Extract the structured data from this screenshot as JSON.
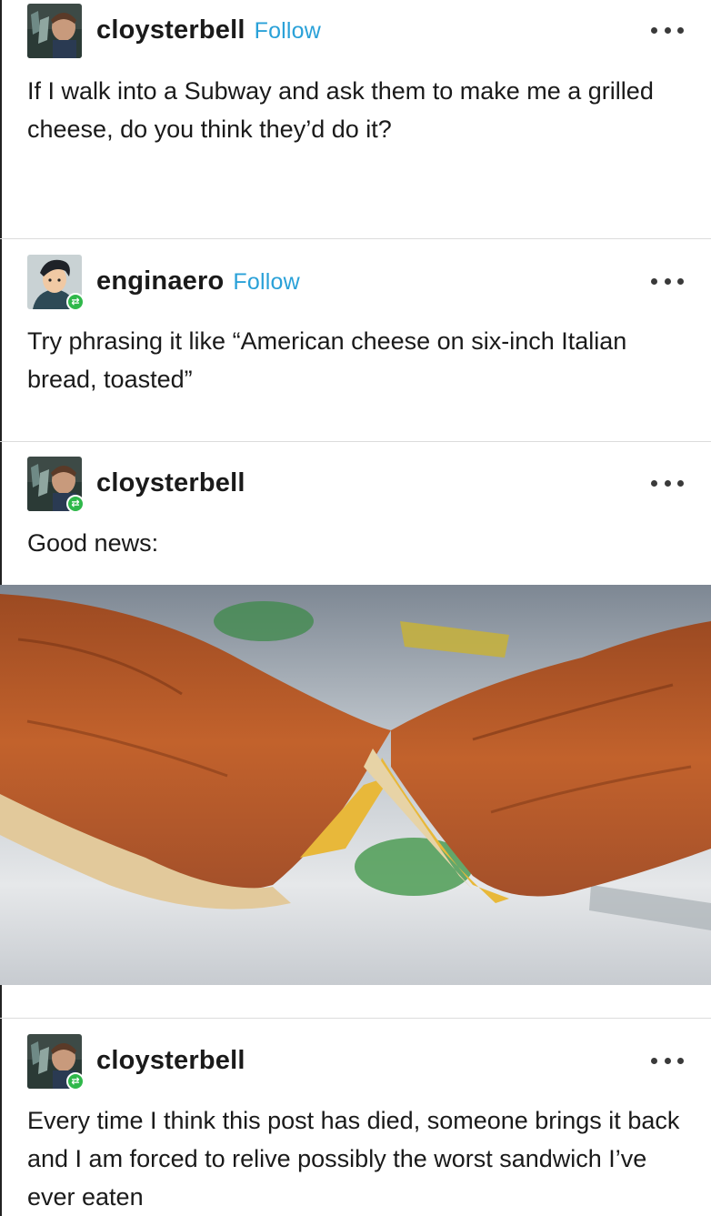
{
  "posts": [
    {
      "username": "cloysterbell",
      "follow_label": "Follow",
      "avatar_icon": "avatar-portrait-icon",
      "text": "If I walk into a Subway and ask them to make me a grilled cheese, do you think they’d do it?"
    },
    {
      "username": "enginaero",
      "follow_label": "Follow",
      "avatar_icon": "avatar-cartoon-icon",
      "reblog_icon": "reblog-badge-icon",
      "text": "Try phrasing it like “American cheese on six-inch Italian bread, toasted”"
    },
    {
      "username": "cloysterbell",
      "avatar_icon": "avatar-portrait-icon",
      "reblog_icon": "reblog-badge-icon",
      "text": "Good news:",
      "image_description_icon": "sandwich-photo"
    },
    {
      "username": "cloysterbell",
      "avatar_icon": "avatar-portrait-icon",
      "reblog_icon": "reblog-badge-icon",
      "text": "Every time I think this post has died, someone brings it back and I am forced to relive possibly the worst sandwich I’ve ever eaten"
    }
  ],
  "more_icon": "more-options-icon",
  "colors": {
    "follow": "#2aa1d8",
    "reblog_badge": "#2fb84a",
    "divider": "#dcdcdc"
  }
}
